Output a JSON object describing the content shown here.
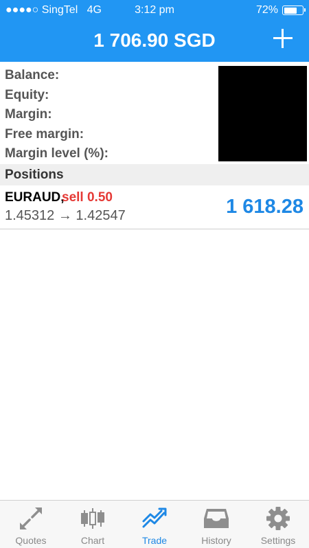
{
  "status_bar": {
    "signal": "●●●●○",
    "carrier": "SingTel",
    "network": "4G",
    "time": "3:12 pm",
    "battery_text": "72%",
    "battery_level": 0.72
  },
  "header": {
    "title": "1 706.90 SGD",
    "add_icon": "plus-icon",
    "background": "#2196f3"
  },
  "account": {
    "labels": [
      "Balance:",
      "Equity:",
      "Margin:",
      "Free margin:",
      "Margin level (%):"
    ]
  },
  "positions": {
    "section_title": "Positions",
    "items": [
      {
        "symbol": "EURAUD,",
        "side": "sell 0.50",
        "prices": "1.45312 → 1.42547",
        "profit": "1 618.28",
        "side_color": "#e53935",
        "profit_color": "#1e88e5"
      }
    ]
  },
  "tabbar": {
    "tabs": [
      {
        "label": "Quotes",
        "icon": "quotes-arrows-icon",
        "active": false
      },
      {
        "label": "Chart",
        "icon": "candlestick-chart-icon",
        "active": false
      },
      {
        "label": "Trade",
        "icon": "trade-trend-icon",
        "active": true
      },
      {
        "label": "History",
        "icon": "history-tray-icon",
        "active": false
      },
      {
        "label": "Settings",
        "icon": "gear-icon",
        "active": false
      }
    ],
    "active_color": "#1e88e5",
    "inactive_color": "#888888"
  }
}
